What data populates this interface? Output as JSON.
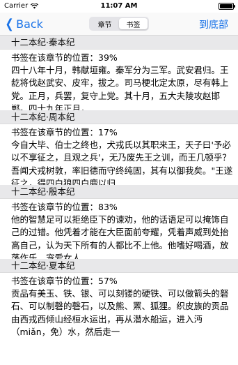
{
  "status_bar": {
    "carrier": "Carrier",
    "time": "11:07 AM"
  },
  "nav": {
    "back_label": "Back",
    "tabs": [
      {
        "label": "章节",
        "active": false
      },
      {
        "label": "书签",
        "active": true
      }
    ],
    "bottom_label": "到底部"
  },
  "colors": {
    "accent": "#1a73e8",
    "section_bg": "#e8e8ea"
  },
  "sections": [
    {
      "title": "十二本纪·秦本纪",
      "position_label": "书签在该章节的位置：",
      "percent": "39%",
      "text": "四十八年十月，韩献垣雍。秦军分为三军。武安君归。王龁将伐赵武安、皮牢，拔之。司马梗北定太原，尽有韩上党。正月，兵罢，复守上党。其十月，五大夫陵攻赵邯郸。四十九年正月，"
    },
    {
      "title": "十二本纪·周本纪",
      "position_label": "书签在该章节的位置：",
      "percent": "17%",
      "text": "今自大毕、伯士之终也，犬戎氏以其职来王，天子曰'予必以不享征之，且观之兵'，无乃废先王之训，而王几顿乎？吾闻犬戎树敦，率旧德而守终纯固，其有以御我矣。\"王遂征之，得四白狼四白鹿以归"
    },
    {
      "title": "十二本纪·殷本纪",
      "position_label": "书签在该章节的位置：",
      "percent": "83%",
      "text": "他的智慧足可以拒绝臣下的谏劝，他的话语足可以掩饰自己的过错。他凭着才能在大臣面前夸耀，凭着声威到处抬高自己，认为天下所有的人都比不上他。他嗜好喝酒，放荡作乐，宠爱女人"
    },
    {
      "title": "十二本纪·夏本纪",
      "position_label": "书签在该章节的位置：",
      "percent": "57%",
      "text": "贡品有美玉、铁、银、可以刻镂的硬铁、可以做箭头的砮石、可以制磬的磬石，以及熊、罴、狐狸。织皮族的贡品由西戎西倾山经桓水运出，再从潜水船运，进入沔（miǎn，免）水，然后走一"
    }
  ]
}
